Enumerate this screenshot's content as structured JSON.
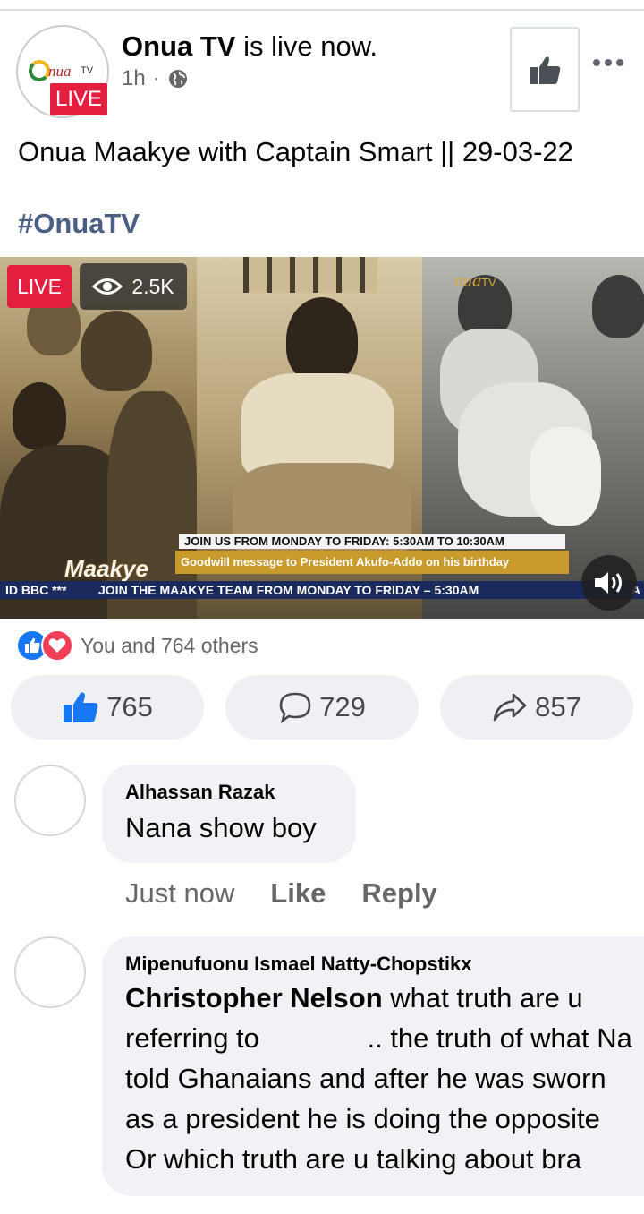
{
  "post": {
    "author": "Onua TV",
    "status_text": "is live now.",
    "time": "1h",
    "separator": "·",
    "avatar_logo_text": "nua",
    "avatar_logo_tv": "TV",
    "live_badge": "LIVE",
    "text": "Onua Maakye with Captain Smart || 29-03-22",
    "hashtag": "#OnuaTV"
  },
  "video": {
    "live_label": "LIVE",
    "views": "2.5K",
    "channel_mark": "nua",
    "channel_mark_tv": "TV",
    "ticker_top": "JOIN US FROM MONDAY TO FRIDAY: 5:30AM TO 10:30AM",
    "ticker_mid": "Goodwill message to President Akufo-Addo on his birthday",
    "show_logo": "Maakye",
    "ticker_bottom_left": "ID BBC ***",
    "ticker_bottom": "JOIN THE MAAKYE TEAM FROM MONDAY TO FRIDAY – 5:30AM",
    "ticker_bottom_end": "A"
  },
  "reactions": {
    "summary": "You and 764 others",
    "types": [
      "like",
      "love"
    ]
  },
  "actions": {
    "likes": "765",
    "comments": "729",
    "shares": "857"
  },
  "comments": [
    {
      "name": "Alhassan Razak",
      "text": "Nana show boy",
      "time": "Just now",
      "like_label": "Like",
      "reply_label": "Reply"
    },
    {
      "name": "Mipenufuonu Ismael Natty-Chopstikx",
      "mention": "Christopher Nelson",
      "line1_rest": "what truth are u",
      "line2": "referring to              .. the truth of what Na",
      "line3": "told Ghanaians and after he was sworn",
      "line4": "as a president he is doing the opposite",
      "line5": "Or which truth are u talking about bra"
    }
  ],
  "colors": {
    "live_red": "#e41e3f",
    "like_blue": "#1877f2",
    "love_red": "#f33e58",
    "hashtag": "#4b5f85",
    "secondary_text": "#65676b"
  }
}
